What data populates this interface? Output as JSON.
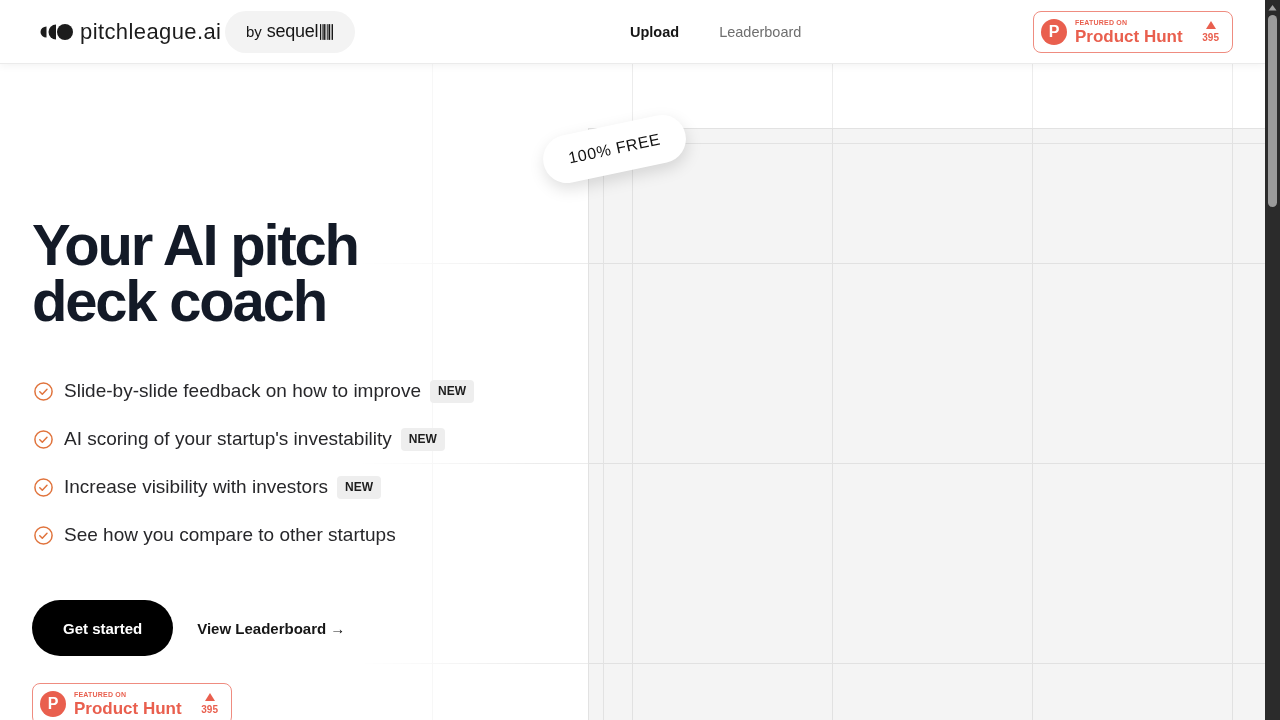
{
  "header": {
    "logo": {
      "name": "pitchleague.ai"
    },
    "partner": {
      "prefix": "by",
      "name": "sequel"
    },
    "nav": [
      {
        "label": "Upload",
        "selected": true
      },
      {
        "label": "Leaderboard",
        "selected": false
      }
    ],
    "product_hunt_badge": {
      "logo_letter": "P",
      "kicker": "FEATURED ON",
      "name": "Product Hunt",
      "votes": "395"
    }
  },
  "hero": {
    "sticker": "100% FREE",
    "title": "Your AI pitch deck coach",
    "features": [
      {
        "text": "Slide-by-slide feedback on how to improve",
        "badge": "NEW"
      },
      {
        "text": "AI scoring of your startup's investability",
        "badge": "NEW"
      },
      {
        "text": "Increase visibility with investors",
        "badge": "NEW"
      },
      {
        "text": "See how you compare to other startups"
      }
    ],
    "actions": [
      {
        "kind": "primary",
        "label": "Get started"
      },
      {
        "kind": "link",
        "label": "View Leaderboard →"
      }
    ],
    "product_hunt_badge": {
      "logo_letter": "P",
      "kicker": "FEATURED ON",
      "name": "Product Hunt",
      "votes": "395"
    }
  }
}
